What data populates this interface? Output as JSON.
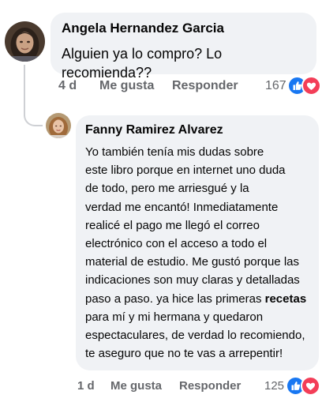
{
  "comment": {
    "author": "Angela Hernandez Garcia",
    "text": "Alguien ya lo compro? Lo recomienda??",
    "time": "4 d",
    "like_label": "Me gusta",
    "reply_label": "Responder",
    "reaction_count": "167",
    "reactions": [
      "like-icon",
      "love-icon"
    ]
  },
  "reply": {
    "author": "Fanny Ramirez Alvarez",
    "lines": [
      "Yo también tenía mis dudas sobre",
      "este libro porque en internet uno duda",
      "de todo, pero me arriesgué y la",
      "verdad me encantó! Inmediatamente",
      "realicé el pago me llegó el correo",
      "electrónico con el acceso a todo el",
      "material de estudio. Me gustó porque las",
      "indicaciones son muy claras y detalladas",
      "paso a paso. ya hice las primeras ",
      "para mí y mi hermana y quedaron",
      "espectaculares, de verdad lo recomiendo,",
      "te aseguro que no te vas a arrepentir!"
    ],
    "bold_word": "recetas",
    "time": "1 d",
    "like_label": "Me gusta",
    "reply_label": "Responder",
    "reaction_count": "125",
    "reactions": [
      "like-icon",
      "love-icon"
    ]
  },
  "colors": {
    "bubble": "#f0f2f5",
    "meta_text": "#65676b",
    "like_blue": "#1877f2",
    "love_red": "#f33e58"
  }
}
